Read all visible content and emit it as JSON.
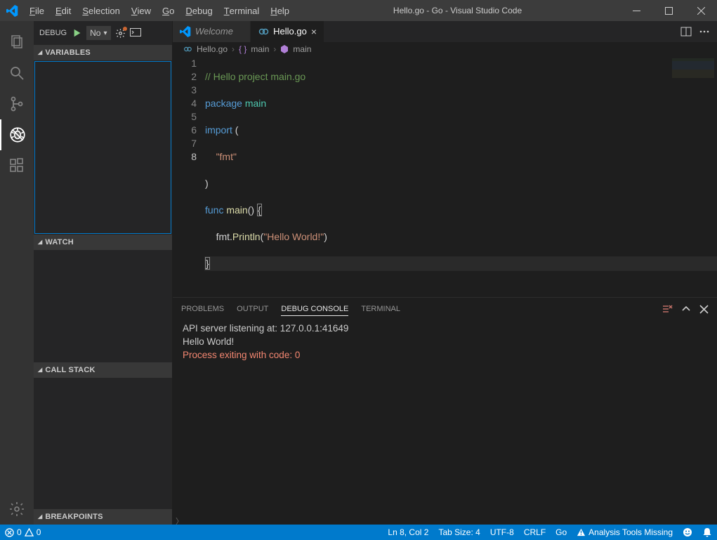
{
  "window": {
    "title": "Hello.go - Go - Visual Studio Code",
    "menu": [
      "File",
      "Edit",
      "Selection",
      "View",
      "Go",
      "Debug",
      "Terminal",
      "Help"
    ]
  },
  "activity": {
    "active": "debug"
  },
  "debug_sidebar": {
    "toolbar_label": "DEBUG",
    "config": "No",
    "sections": {
      "variables": "VARIABLES",
      "watch": "WATCH",
      "call_stack": "CALL STACK",
      "breakpoints": "BREAKPOINTS"
    }
  },
  "tabs": [
    {
      "label": "Welcome",
      "active": false
    },
    {
      "label": "Hello.go",
      "active": true
    }
  ],
  "breadcrumbs": {
    "file": "Hello.go",
    "symbol1": "main",
    "symbol2": "main"
  },
  "editor": {
    "filename": "Hello.go",
    "line_numbers": [
      "1",
      "2",
      "3",
      "4",
      "5",
      "6",
      "7",
      "8"
    ],
    "tokens": {
      "l1_comment": "// Hello project main.go",
      "l2_kw": "package",
      "l2_id": "main",
      "l3_kw": "import",
      "l3_p": "(",
      "l4_str": "\"fmt\"",
      "l5_p": ")",
      "l6_kw": "func",
      "l6_fn": "main",
      "l6_par": "()",
      "l6_brace": "{",
      "l7_indent": "    ",
      "l7_pkg": "fmt",
      "l7_dot": ".",
      "l7_fn": "Println",
      "l7_open": "(",
      "l7_str": "\"Hello World!\"",
      "l7_close": ")",
      "l8_brace": "}"
    }
  },
  "panel": {
    "tabs": [
      "PROBLEMS",
      "OUTPUT",
      "DEBUG CONSOLE",
      "TERMINAL"
    ],
    "active": "DEBUG CONSOLE",
    "lines": [
      {
        "text": "API server listening at: 127.0.0.1:41649",
        "class": ""
      },
      {
        "text": "Hello World!",
        "class": ""
      },
      {
        "text": "Process exiting with code: 0",
        "class": "red"
      }
    ]
  },
  "status": {
    "errors": "0",
    "warnings": "0",
    "ln_col": "Ln 8, Col 2",
    "tab_size": "Tab Size: 4",
    "encoding": "UTF-8",
    "eol": "CRLF",
    "lang": "Go",
    "warning_msg": "Analysis Tools Missing"
  }
}
